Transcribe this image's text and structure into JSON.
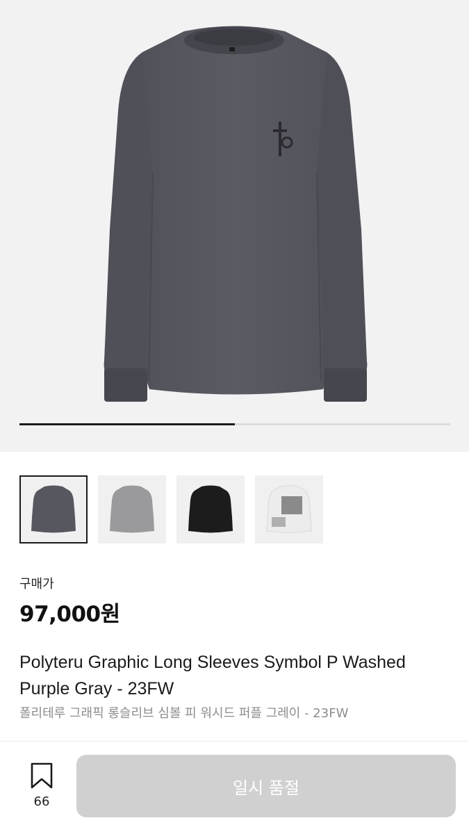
{
  "product": {
    "image_progress": 0.5,
    "thumbnails": [
      {
        "name": "purple-gray",
        "color": "#57575f",
        "selected": true
      },
      {
        "name": "gray",
        "color": "#9a9a9c",
        "selected": false
      },
      {
        "name": "black",
        "color": "#1c1c1c",
        "selected": false
      },
      {
        "name": "white",
        "color": "#ececec",
        "selected": false
      }
    ],
    "price_label": "구매가",
    "price": "97,000원",
    "title_en": "Polyteru Graphic Long Sleeves Symbol P Washed Purple Gray - 23FW",
    "title_ko": "폴리테루 그래픽 롱슬리브 심볼 피 워시드 퍼플 그레이 - 23FW"
  },
  "footer": {
    "wish_count": "66",
    "buy_label": "일시 품절"
  },
  "colors": {
    "shirt": "#57575f",
    "hero_bg": "#f2f2f3",
    "button_disabled": "#d0d0d0"
  }
}
